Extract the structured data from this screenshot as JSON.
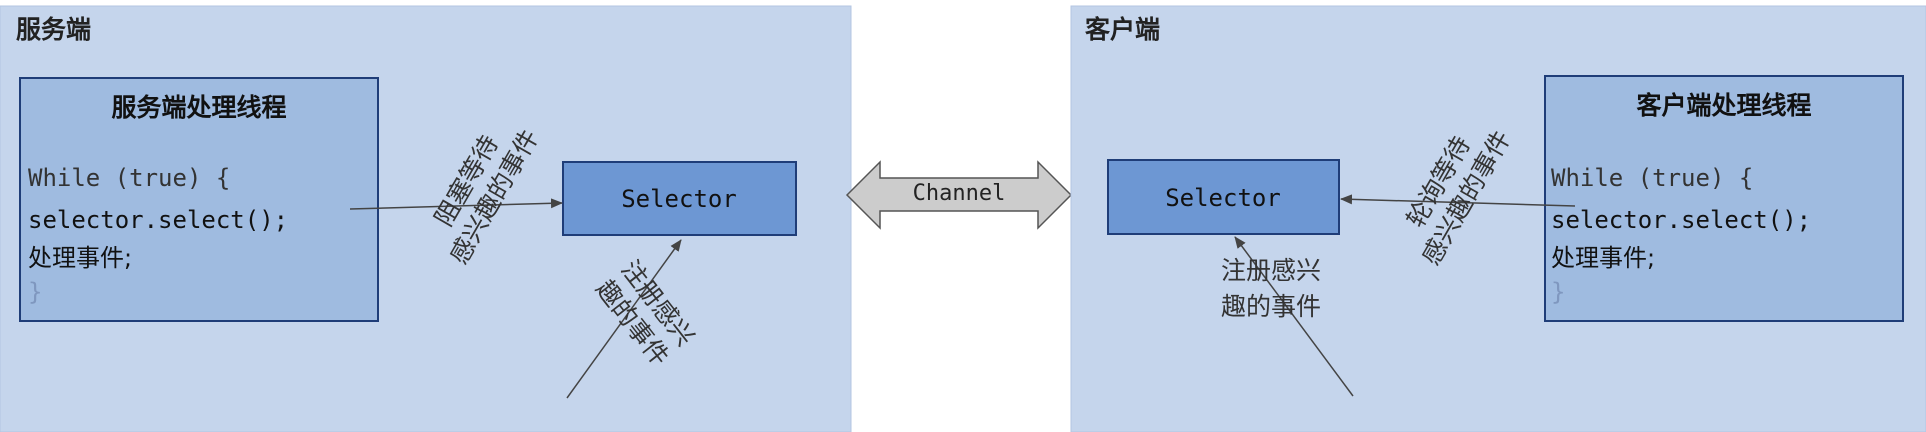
{
  "server": {
    "title": "服务端",
    "thread_title": "服务端处理线程",
    "code": [
      "While (true) {",
      "selector.select();",
      "处理事件;",
      "}"
    ],
    "selector_label": "Selector",
    "wait_label": [
      "阻塞等待",
      "感兴趣的事件"
    ],
    "register_label": [
      "注册感兴",
      "趣的事件"
    ]
  },
  "client": {
    "title": "客户端",
    "thread_title": "客户端处理线程",
    "code": [
      "While (true) {",
      "selector.select();",
      "处理事件;",
      "}"
    ],
    "selector_label": "Selector",
    "poll_label": [
      "轮询等待",
      "感兴趣的事件"
    ],
    "register_label": [
      "注册感兴",
      "趣的事件"
    ]
  },
  "channel": {
    "label": "Channel"
  },
  "colors": {
    "panel": "#c5d5ec",
    "thread_box": "#9fbbe0",
    "selector_box": "#6d97d3",
    "border": "#1f3d78",
    "arrow": "#555555",
    "channel_fill": "#cccccc"
  }
}
